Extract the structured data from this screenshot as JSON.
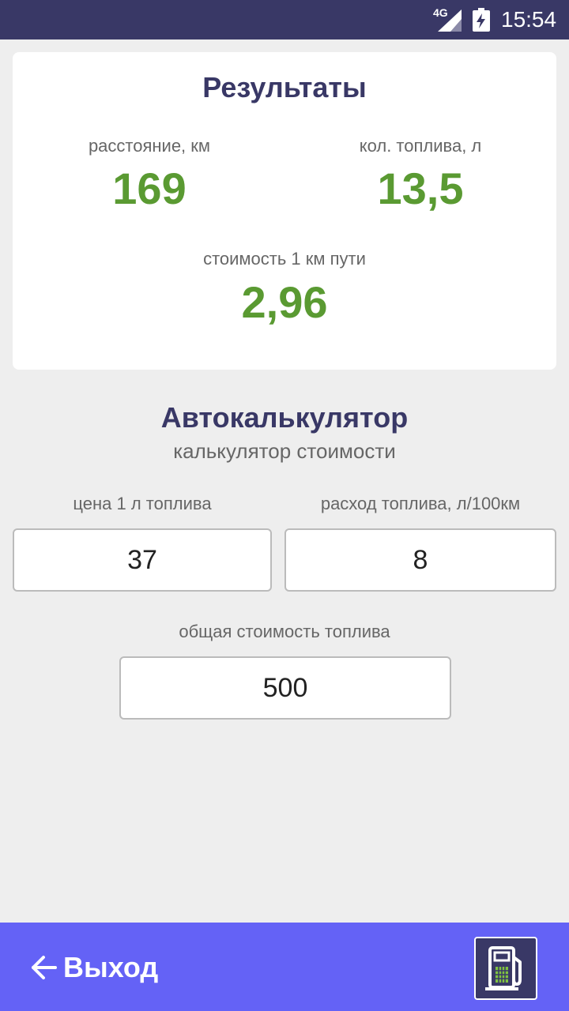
{
  "status_bar": {
    "network_label": "4G",
    "time": "15:54",
    "signal_icon": "cell-signal-icon",
    "battery_icon": "battery-charging-icon"
  },
  "results": {
    "title": "Результаты",
    "distance_label": "расстояние, км",
    "distance_value": "169",
    "fuel_amount_label": "кол. топлива, л",
    "fuel_amount_value": "13,5",
    "cost_per_km_label": "стоимость 1 км пути",
    "cost_per_km_value": "2,96"
  },
  "calculator": {
    "title": "Автокалькулятор",
    "subtitle": "калькулятор стоимости",
    "fuel_price_label": "цена 1 л топлива",
    "fuel_price_value": "37",
    "consumption_label": "расход топлива, л/100км",
    "consumption_value": "8",
    "total_cost_label": "общая стоимость топлива",
    "total_cost_value": "500"
  },
  "bottom_bar": {
    "exit_label": "Выход",
    "exit_icon": "arrow-left-icon",
    "fuel_icon": "fuel-pump-calculator-icon"
  },
  "colors": {
    "status_bar": "#393866",
    "bottom_bar": "#6462f6",
    "title": "#393866",
    "value_green": "#5a9a32",
    "background": "#eeeeee"
  }
}
